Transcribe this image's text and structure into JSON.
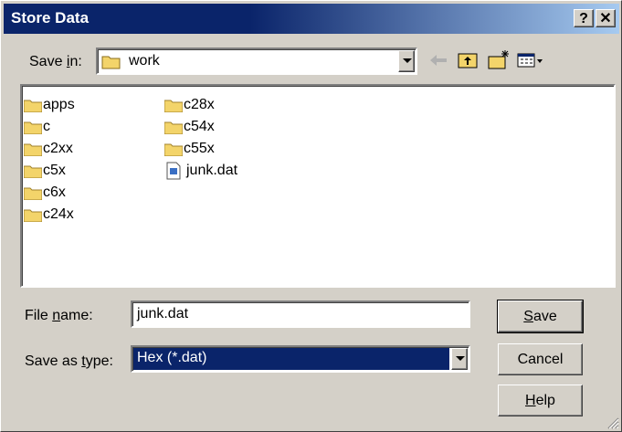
{
  "window": {
    "title": "Store Data"
  },
  "titlebar_buttons": {
    "help": "?",
    "close": "✕"
  },
  "toolbar": {
    "save_in_label": "Save in:",
    "save_in_accel": "i",
    "location": "work"
  },
  "files": {
    "col1": [
      "apps",
      "c",
      "c2xx",
      "c5x",
      "c6x",
      "c24x"
    ],
    "col2_folders": [
      "c28x",
      "c54x",
      "c55x"
    ],
    "col2_file": "junk.dat"
  },
  "form": {
    "file_name_label": "File name:",
    "file_name_value": "junk.dat",
    "save_type_label": "Save as type:",
    "save_type_value": "Hex (*.dat)"
  },
  "buttons": {
    "save": "Save",
    "cancel": "Cancel",
    "help": "Help"
  },
  "colors": {
    "title_bar": "#0a246a",
    "face": "#d4d0c8",
    "selection": "#0a246a",
    "folder": "#f3d46a"
  }
}
